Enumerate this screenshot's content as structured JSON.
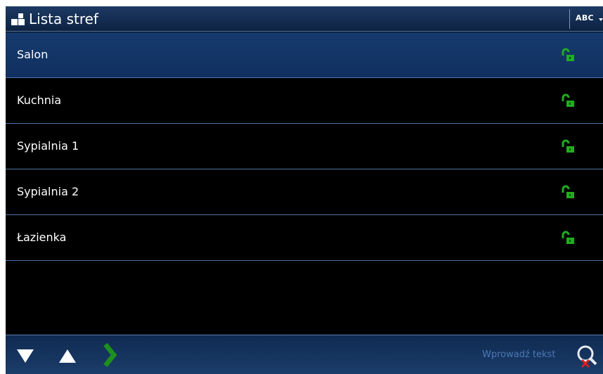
{
  "header": {
    "title": "Lista stref",
    "keyboard_mode": "ABC"
  },
  "zones": [
    {
      "name": "Salon",
      "status_icon": "unlocked-icon",
      "selected": true
    },
    {
      "name": "Kuchnia",
      "status_icon": "unlocked-icon",
      "selected": false
    },
    {
      "name": "Sypialnia 1",
      "status_icon": "unlocked-icon",
      "selected": false
    },
    {
      "name": "Sypialnia 2",
      "status_icon": "unlocked-icon",
      "selected": false
    },
    {
      "name": "Łazienka",
      "status_icon": "unlocked-icon",
      "selected": false
    }
  ],
  "footer": {
    "search_placeholder": "Wprowadź tekst",
    "buttons": [
      "scroll-down-icon",
      "scroll-up-icon",
      "next-icon",
      "search-clear-icon"
    ]
  },
  "colors": {
    "accent_blue": "#1d3a63",
    "status_green": "#1fae1f",
    "arrow_green": "#1e8f1e",
    "divider": "#4f74a6",
    "placeholder": "#4b78b4"
  }
}
